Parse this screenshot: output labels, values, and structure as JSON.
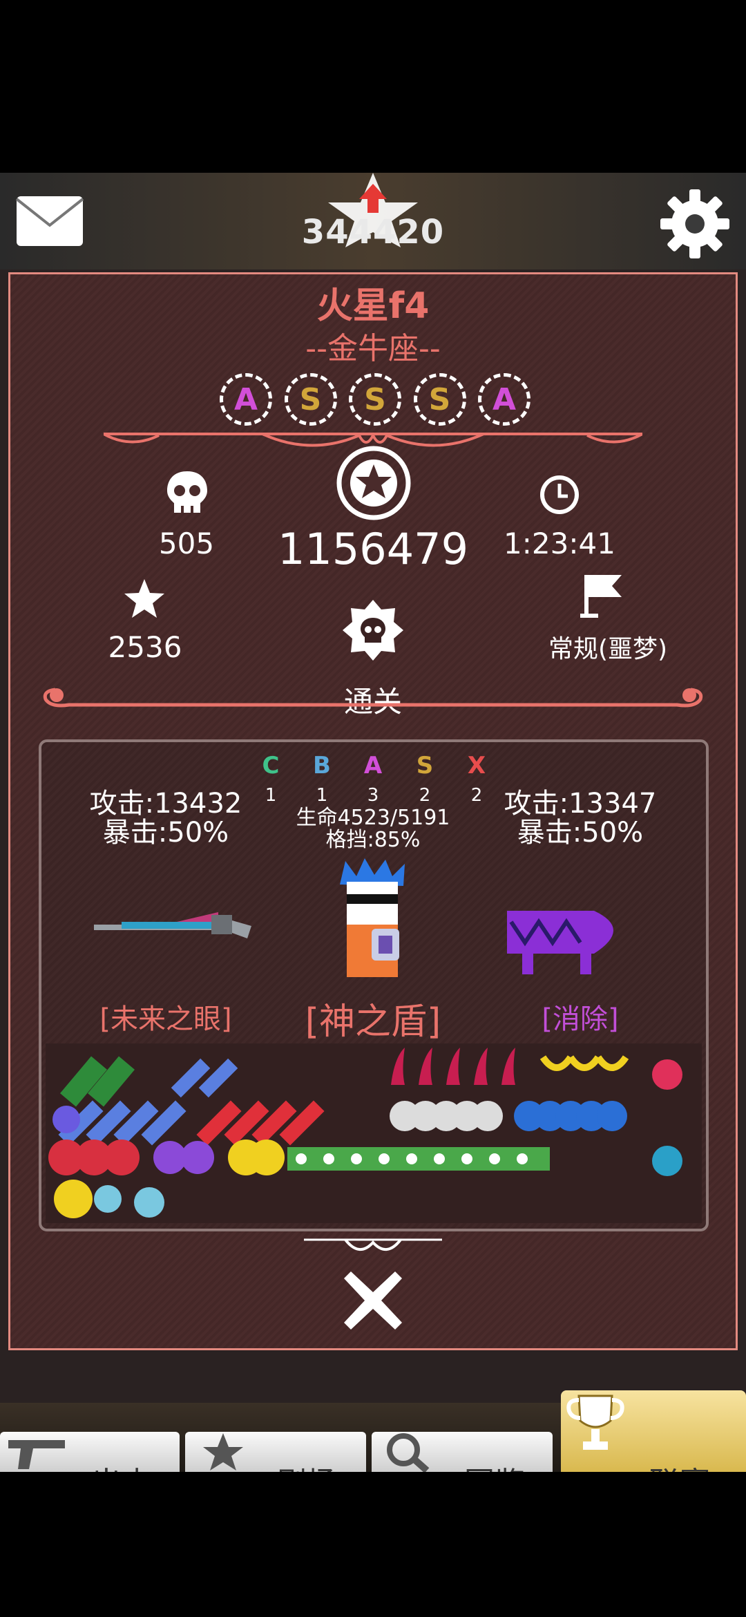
{
  "header": {
    "score": "344420"
  },
  "level": {
    "title": "火星f4",
    "subtitle": "--金牛座--"
  },
  "ranks": [
    {
      "letter": "A",
      "color": "#d24fd8"
    },
    {
      "letter": "S",
      "color": "#d2a63a"
    },
    {
      "letter": "S",
      "color": "#d2a63a"
    },
    {
      "letter": "S",
      "color": "#d2a63a"
    },
    {
      "letter": "A",
      "color": "#d24fd8"
    }
  ],
  "stats": {
    "kills": "505",
    "score": "1156479",
    "time": "1:23:41",
    "stars": "2536",
    "result": "通关",
    "mode": "常规(噩梦)"
  },
  "grades": [
    {
      "letter": "C",
      "count": "1",
      "color": "#3fc28a"
    },
    {
      "letter": "B",
      "count": "1",
      "color": "#5aa7d9"
    },
    {
      "letter": "A",
      "count": "3",
      "color": "#d24fd8"
    },
    {
      "letter": "S",
      "count": "2",
      "color": "#d2a63a"
    },
    {
      "letter": "X",
      "count": "2",
      "color": "#e84d4d"
    }
  ],
  "left_weapon": {
    "attack": "攻击:13432",
    "crit": "暴击:50%",
    "name": "[未来之眼]",
    "color": "#e9736b"
  },
  "right_weapon": {
    "attack": "攻击:13347",
    "crit": "暴击:50%",
    "name": "[消除]",
    "color": "#c24fd8"
  },
  "character": {
    "hp": "生命4523/5191",
    "block": "格挡:85%",
    "shield": "[神之盾]",
    "color": "#e9736b"
  },
  "nav": [
    {
      "label": "出击",
      "icon": "gun-icon"
    },
    {
      "label": "剧场",
      "icon": "star-icon"
    },
    {
      "label": "图鉴",
      "icon": "magnifier-icon"
    },
    {
      "label": "联赛",
      "icon": "trophy-icon"
    }
  ],
  "colors": {
    "accent": "#e9736b",
    "panel": "#4a2b2b",
    "active_tab": "#f2d27a"
  }
}
